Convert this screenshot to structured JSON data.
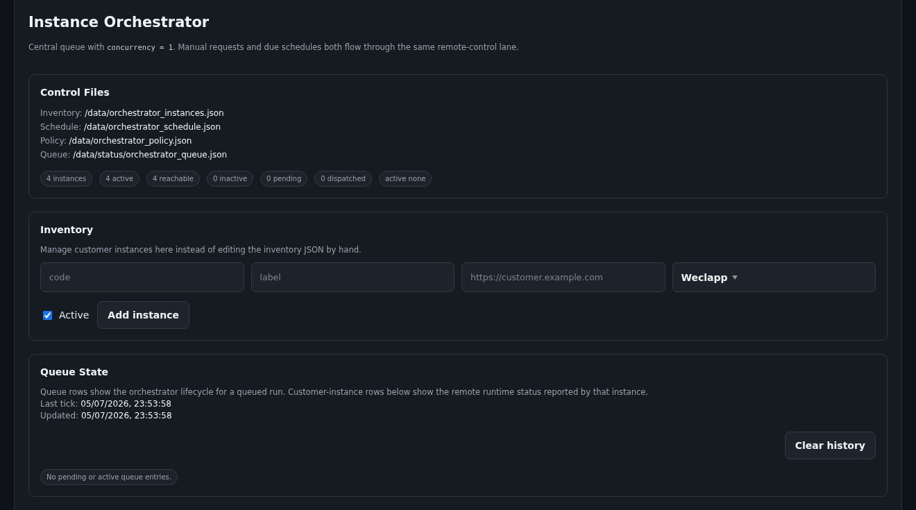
{
  "header": {
    "title": "Instance Orchestrator",
    "subtitle": [
      {
        "kind": "text",
        "text": "Central queue with "
      },
      {
        "kind": "code",
        "text": "concurrency = 1"
      },
      {
        "kind": "text",
        "text": ". Manual requests and due schedules both flow through the same remote-control lane."
      }
    ]
  },
  "control_files": {
    "title": "Control Files",
    "files": [
      {
        "label": "Inventory:",
        "path": "/data/orchestrator_instances.json"
      },
      {
        "label": "Schedule:",
        "path": "/data/orchestrator_schedule.json"
      },
      {
        "label": "Policy:",
        "path": "/data/orchestrator_policy.json"
      },
      {
        "label": "Queue:",
        "path": "/data/status/orchestrator_queue.json"
      }
    ],
    "chips": [
      "4 instances",
      "4 active",
      "4 reachable",
      "0 inactive",
      "0 pending",
      "0 dispatched",
      "active none"
    ]
  },
  "inventory": {
    "title": "Inventory",
    "description": "Manage customer instances here instead of editing the inventory JSON by hand.",
    "fields": [
      {
        "placeholder": "code"
      },
      {
        "placeholder": "label"
      },
      {
        "placeholder": "https://customer.example.com"
      }
    ],
    "platform": {
      "value": "Weclapp"
    },
    "active": {
      "label": "Active",
      "checked": true
    },
    "add_button": "Add instance"
  },
  "queue_state": {
    "title": "Queue State",
    "description": "Queue rows show the orchestrator lifecycle for a queued run. Customer-instance rows below show the remote runtime status reported by that instance.",
    "meta": [
      {
        "label": "Last tick:",
        "value": "05/07/2026, 23:53:58"
      },
      {
        "label": "Updated:",
        "value": "05/07/2026, 23:53:58"
      }
    ],
    "clear_button": "Clear history",
    "empty_note": "No pending or active queue entries."
  }
}
